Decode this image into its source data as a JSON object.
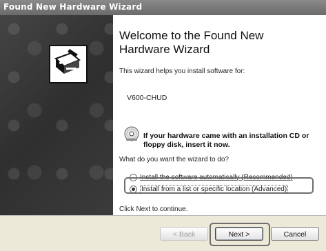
{
  "window": {
    "title": "Found New Hardware Wizard"
  },
  "welcome": {
    "title": "Welcome to the Found New Hardware Wizard",
    "intro": "This wizard helps you install software for:",
    "device_name": "V600-CHUD"
  },
  "cd_hint": {
    "icon": "cd-icon",
    "text": "If your hardware came with an installation CD or floppy disk, insert it now."
  },
  "options": {
    "question": "What do you want the wizard to do?",
    "auto_label": "Install the software automatically (Recommended)",
    "manual_label": "Install from a list or specific location (Advanced)",
    "selected": "manual"
  },
  "footer": {
    "continue_text": "Click Next to continue.",
    "back_label": "< Back",
    "next_label": "Next >",
    "cancel_label": "Cancel"
  }
}
